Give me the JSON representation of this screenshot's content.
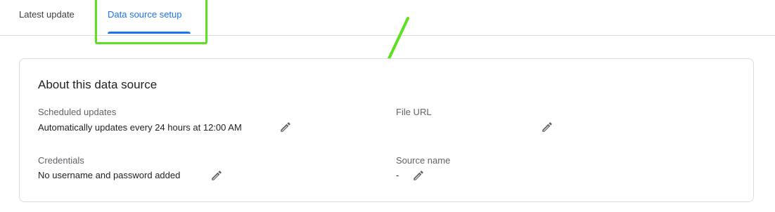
{
  "tabs": [
    {
      "label": "Latest update",
      "active": false
    },
    {
      "label": "Data source setup",
      "active": true
    }
  ],
  "card": {
    "title": "About this data source",
    "scheduled_updates": {
      "label": "Scheduled updates",
      "value": "Automatically updates every 24 hours at 12:00 AM"
    },
    "file_url": {
      "label": "File URL",
      "value": ""
    },
    "credentials": {
      "label": "Credentials",
      "value": "No username and password added"
    },
    "source_name": {
      "label": "Source name",
      "value": "-"
    }
  },
  "icons": {
    "edit": "pencil-icon"
  },
  "colors": {
    "accent": "#1a73e8",
    "annotation": "#5ce01f",
    "border": "#dadce0"
  }
}
